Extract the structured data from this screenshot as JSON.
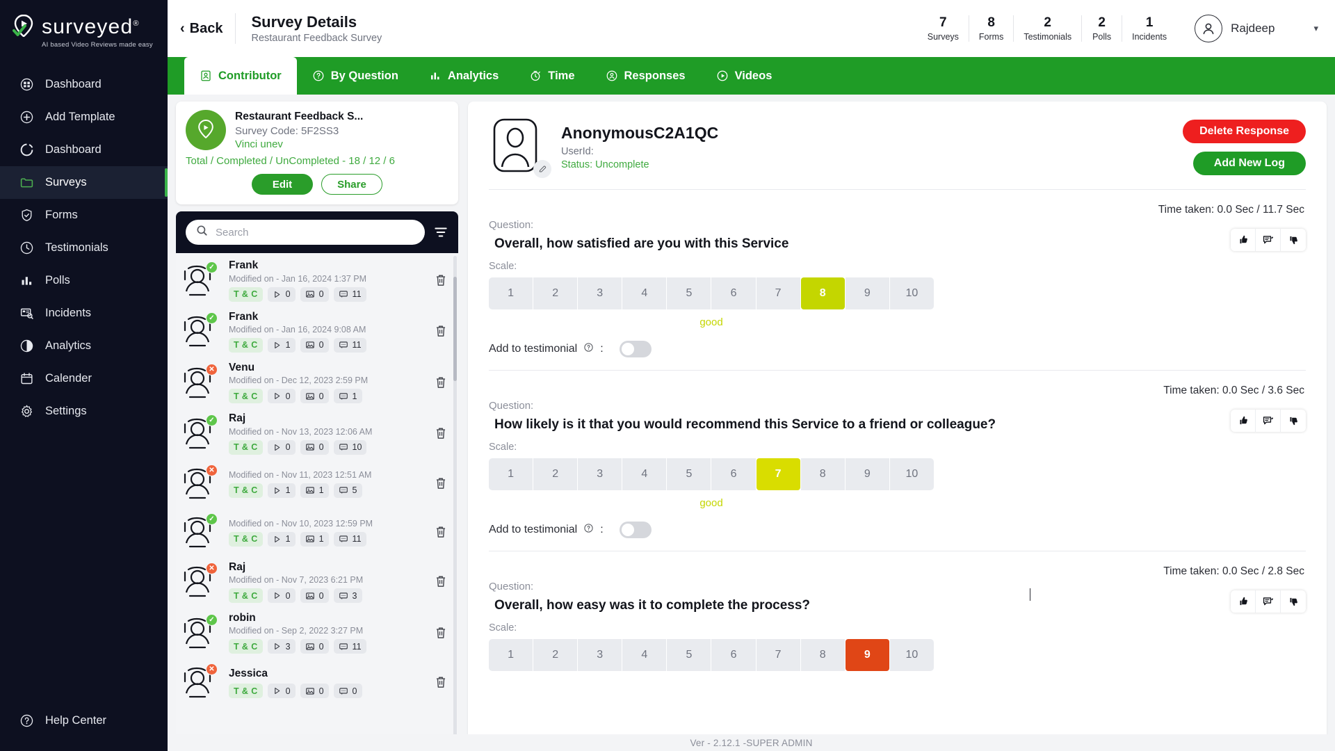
{
  "brand": {
    "word": "surveyed",
    "reg": "®",
    "tagline": "AI based Video Reviews made easy"
  },
  "sidebar": {
    "items": [
      {
        "label": "Dashboard",
        "icon": "dashboard-grid-icon",
        "active": false
      },
      {
        "label": "Add Template",
        "icon": "plus-circle-icon",
        "active": false
      },
      {
        "label": "Dashboard",
        "icon": "donut-icon",
        "active": false
      },
      {
        "label": "Surveys",
        "icon": "folder-icon",
        "active": true
      },
      {
        "label": "Forms",
        "icon": "shield-check-icon",
        "active": false
      },
      {
        "label": "Testimonials",
        "icon": "clock-icon",
        "active": false
      },
      {
        "label": "Polls",
        "icon": "bar-chart-icon",
        "active": false
      },
      {
        "label": "Incidents",
        "icon": "incident-search-icon",
        "active": false
      },
      {
        "label": "Analytics",
        "icon": "pie-chart-icon",
        "active": false
      },
      {
        "label": "Calender",
        "icon": "calendar-icon",
        "active": false
      },
      {
        "label": "Settings",
        "icon": "gear-icon",
        "active": false
      }
    ],
    "help": {
      "label": "Help Center",
      "icon": "question-circle-icon"
    }
  },
  "topbar": {
    "back_label": "Back",
    "title": "Survey Details",
    "subtitle": "Restaurant Feedback Survey",
    "stats": [
      {
        "value": "7",
        "label": "Surveys"
      },
      {
        "value": "8",
        "label": "Forms"
      },
      {
        "value": "2",
        "label": "Testimonials"
      },
      {
        "value": "2",
        "label": "Polls"
      },
      {
        "value": "1",
        "label": "Incidents"
      }
    ],
    "profile_name": "Rajdeep",
    "caret": "▾"
  },
  "tabs": [
    {
      "label": "Contributor",
      "icon": "contributor-icon",
      "active": true
    },
    {
      "label": "By Question",
      "icon": "question-circle-icon",
      "active": false
    },
    {
      "label": "Analytics",
      "icon": "bar-chart-icon",
      "active": false
    },
    {
      "label": "Time",
      "icon": "stopwatch-icon",
      "active": false
    },
    {
      "label": "Responses",
      "icon": "responses-icon",
      "active": false
    },
    {
      "label": "Videos",
      "icon": "play-circle-icon",
      "active": false
    }
  ],
  "survey_card": {
    "name": "Restaurant Feedback S...",
    "code": "Survey Code: 5F2SS3",
    "owner": "Vinci unev",
    "totals": "Total / Completed / UnCompleted - 18 / 12 / 6",
    "edit_label": "Edit",
    "share_label": "Share"
  },
  "search": {
    "placeholder": "Search",
    "value": ""
  },
  "contributors": [
    {
      "name": "Frank",
      "status": "ok",
      "date": "Modified on - Jan 16, 2024 1:37 PM",
      "tc": "T & C",
      "plays": "0",
      "images": "0",
      "comments": "11"
    },
    {
      "name": "Frank",
      "status": "ok",
      "date": "Modified on - Jan 16, 2024 9:08 AM",
      "tc": "T & C",
      "plays": "1",
      "images": "0",
      "comments": "11"
    },
    {
      "name": "Venu",
      "status": "no",
      "date": "Modified on - Dec 12, 2023 2:59 PM",
      "tc": "T & C",
      "plays": "0",
      "images": "0",
      "comments": "1"
    },
    {
      "name": "Raj",
      "status": "ok",
      "date": "Modified on - Nov 13, 2023 12:06 AM",
      "tc": "T & C",
      "plays": "0",
      "images": "0",
      "comments": "10"
    },
    {
      "name": "",
      "status": "no",
      "date": "Modified on - Nov 11, 2023 12:51 AM",
      "tc": "T & C",
      "plays": "1",
      "images": "1",
      "comments": "5"
    },
    {
      "name": "",
      "status": "ok",
      "date": "Modified on - Nov 10, 2023 12:59 PM",
      "tc": "T & C",
      "plays": "1",
      "images": "1",
      "comments": "11"
    },
    {
      "name": "Raj",
      "status": "no",
      "date": "Modified on - Nov 7, 2023 6:21 PM",
      "tc": "T & C",
      "plays": "0",
      "images": "0",
      "comments": "3"
    },
    {
      "name": "robin",
      "status": "ok",
      "date": "Modified on - Sep 2, 2022 3:27 PM",
      "tc": "T & C",
      "plays": "3",
      "images": "0",
      "comments": "11"
    },
    {
      "name": "Jessica",
      "status": "no",
      "date": "",
      "tc": "T & C",
      "plays": "0",
      "images": "0",
      "comments": "0"
    }
  ],
  "response": {
    "name": "AnonymousC2A1QC",
    "userid": "UserId:",
    "status": "Status: Uncomplete",
    "delete_label": "Delete Response",
    "add_log_label": "Add New Log"
  },
  "labels": {
    "question": "Question:",
    "scale": "Scale:",
    "add_to_testimonial": "Add to testimonial",
    "help_glyph": "?",
    "colon": ":"
  },
  "questions": [
    {
      "time_taken": "Time taken: 0.0 Sec / 11.7 Sec",
      "text": "Overall, how satisfied are you with this Service",
      "scale_options": [
        "1",
        "2",
        "3",
        "4",
        "5",
        "6",
        "7",
        "8",
        "9",
        "10"
      ],
      "selected": "8",
      "selected_color": "#c4d600",
      "scale_word": "good",
      "testimonial_on": false
    },
    {
      "time_taken": "Time taken: 0.0 Sec / 3.6 Sec",
      "text": "How likely is it that you would recommend this Service to a friend or colleague?",
      "scale_options": [
        "1",
        "2",
        "3",
        "4",
        "5",
        "6",
        "7",
        "8",
        "9",
        "10"
      ],
      "selected": "7",
      "selected_color": "#d9dd00",
      "scale_word": "good",
      "testimonial_on": false
    },
    {
      "time_taken": "Time taken: 0.0 Sec / 2.8 Sec",
      "text": "Overall, how easy was it to complete the process?",
      "scale_options": [
        "1",
        "2",
        "3",
        "4",
        "5",
        "6",
        "7",
        "8",
        "9",
        "10"
      ],
      "selected": "9",
      "selected_color": "#e04616",
      "scale_word": "",
      "testimonial_on": false
    }
  ],
  "footer": {
    "version": "Ver - 2.12.1 -SUPER ADMIN"
  },
  "colors": {
    "sidebar_bg": "#0d1020",
    "brand_green": "#1f9c26",
    "accent_green": "#3faa3f",
    "danger_red": "#ee1f1f",
    "scale_green": "#c4d600",
    "scale_yellow": "#d9dd00",
    "scale_orange": "#e04616"
  }
}
